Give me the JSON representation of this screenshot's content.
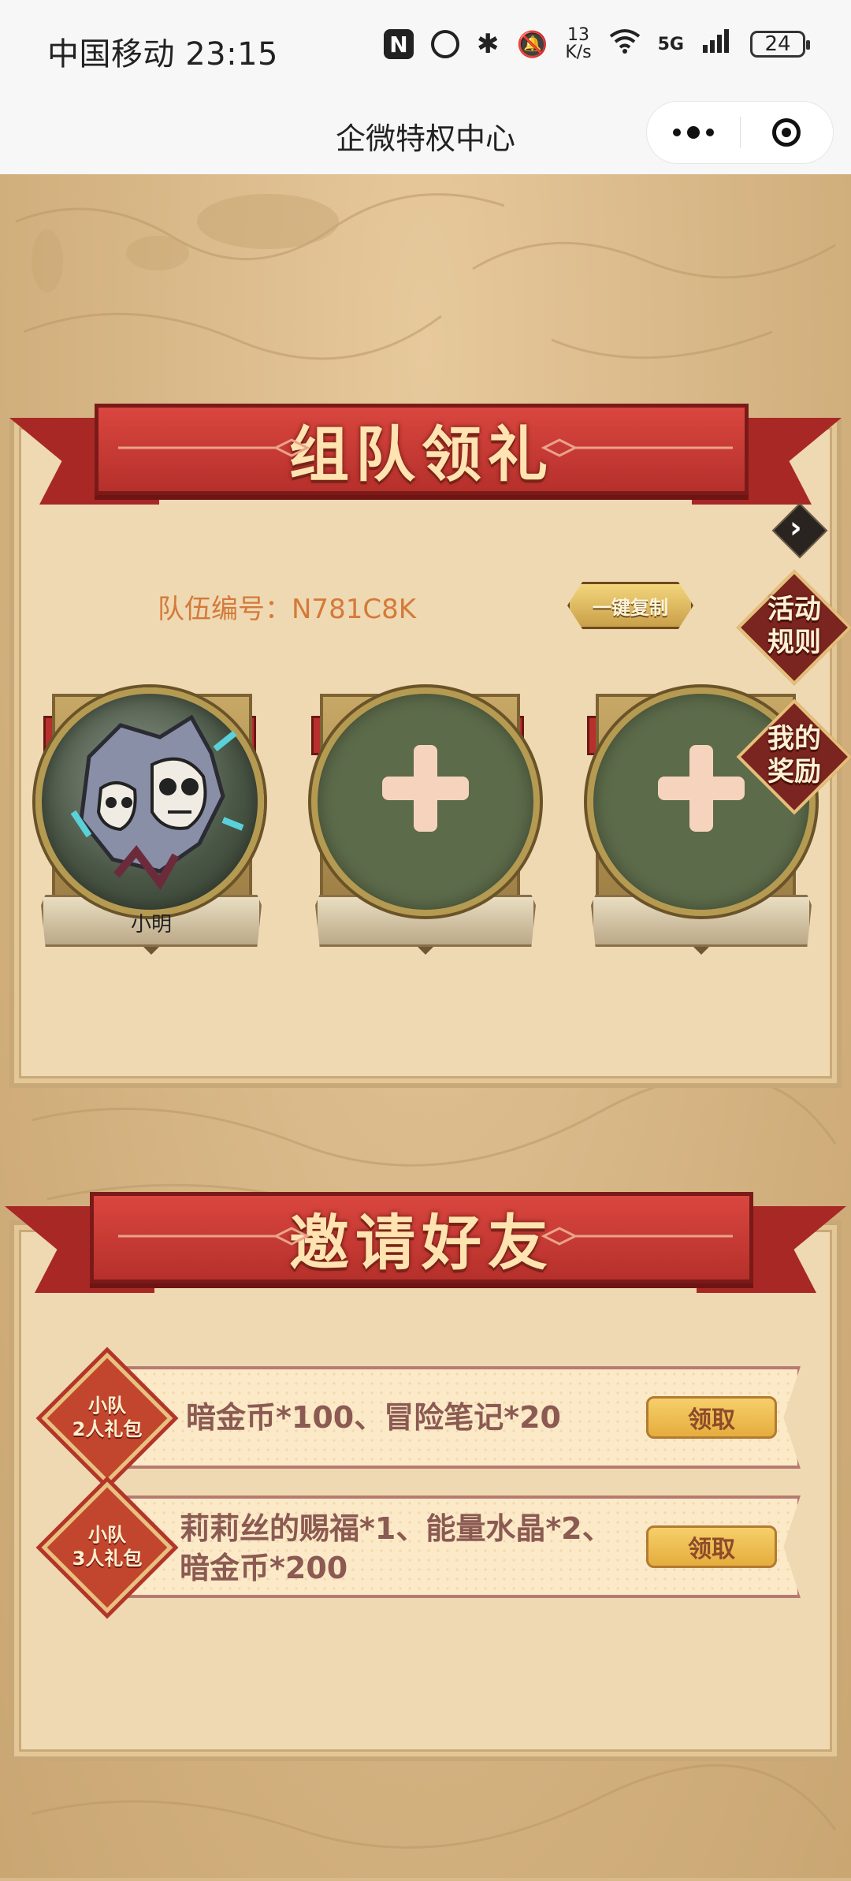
{
  "status_bar": {
    "carrier_time": "中国移动 23:15",
    "nfc_label": "N",
    "speed_top": "13",
    "speed_bottom": "K/s",
    "network": "5G",
    "battery": "24"
  },
  "title_bar": {
    "title": "企微特权中心"
  },
  "team_section": {
    "banner_title": "组队领礼",
    "team_number": "队伍编号：N781C8K",
    "copy_button": "一键复制",
    "rules_button": [
      "活动",
      "规则"
    ],
    "rewards_button": [
      "我的",
      "奖励"
    ],
    "members": [
      {
        "name": "小明",
        "filled": true
      },
      {
        "name": "",
        "filled": false
      },
      {
        "name": "",
        "filled": false
      }
    ]
  },
  "invite_section": {
    "banner_title": "邀请好友",
    "rewards": [
      {
        "badge_line1": "小队",
        "badge_line2": "2人礼包",
        "text_line1": "暗金币*100、冒险笔记*20",
        "text_line2": "",
        "button": "领取"
      },
      {
        "badge_line1": "小队",
        "badge_line2": "3人礼包",
        "text_line1": "莉莉丝的赐福*1、能量水晶*2、",
        "text_line2": "暗金币*200",
        "button": "领取"
      }
    ]
  },
  "colors": {
    "banner_red": "#c93a34",
    "panel": "#efd9b2",
    "team_number": "#d47a3a",
    "claim_button": "#f0c258"
  }
}
